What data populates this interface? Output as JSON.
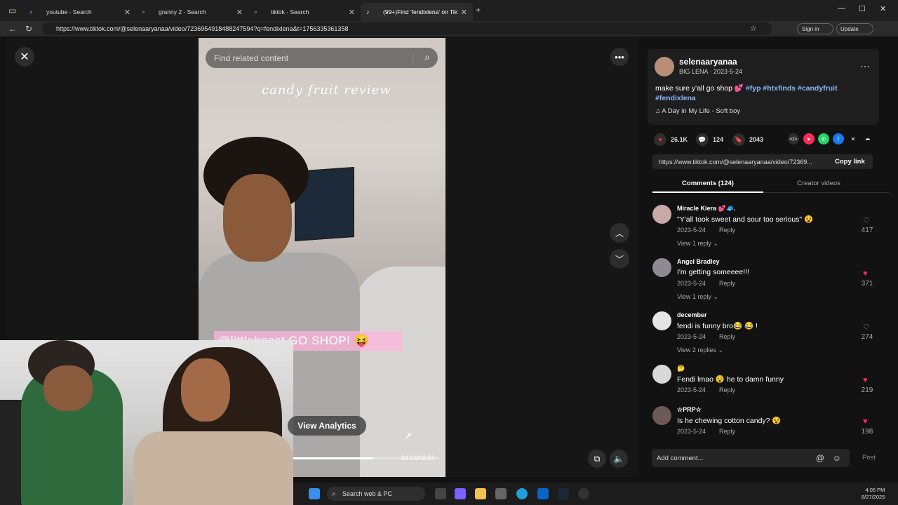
{
  "browser": {
    "tabs": [
      {
        "title": "youtube - Search"
      },
      {
        "title": "granny 2 - Search"
      },
      {
        "title": "tiktok - Search"
      },
      {
        "title": "(99+)Find 'fendixlena' on Tik"
      }
    ],
    "url": "https://www.tiktok.com/@selenaaryanaa/video/7236954918488247594?q=fendixlena&t=1756335361358",
    "sign_in": "Sign in",
    "update": "Update"
  },
  "video": {
    "search_placeholder": "Find related content",
    "overlay_title": "candy fruit review",
    "overlay_caption": "@littlebeast GO SHOP! 😝",
    "analytics_button": "View Analytics",
    "time": "02:34/02:53",
    "progress_fraction": 0.55
  },
  "post": {
    "username": "selenaaryanaa",
    "subtitle": "BIG LENA · 2023-5-24",
    "description": "make sure y'all go shop 💕 ",
    "hashtags": [
      "#fyp",
      "#htxfinds",
      "#candyfruit",
      "#fendixlena"
    ],
    "music": "A Day in My Life - Soft boy",
    "likes": "26.1K",
    "comments": "124",
    "saves": "2043",
    "link": "https://www.tiktok.com/@selenaaryanaa/video/72369...",
    "copy_link": "Copy link",
    "tab_comments": "Comments (124)",
    "tab_creator": "Creator videos",
    "add_comment_placeholder": "Add comment...",
    "post_button": "Post"
  },
  "comments": [
    {
      "name": "Miracle Kiera 💕🧢.",
      "text": "\"Y'all took sweet and sour too serious\" 😵",
      "date": "2023-5-24",
      "reply": "Reply",
      "count": "417",
      "liked": false,
      "view_replies": "View 1 reply ⌄"
    },
    {
      "name": "Angel Bradley",
      "text": "I'm getting someeee!!!",
      "date": "2023-5-24",
      "reply": "Reply",
      "count": "371",
      "liked": true,
      "view_replies": "View 1 reply ⌄"
    },
    {
      "name": "december",
      "text": "fendi is funny bro😂 😂 !",
      "date": "2023-5-24",
      "reply": "Reply",
      "count": "274",
      "liked": false,
      "view_replies": "View 2 replies ⌄"
    },
    {
      "name": "🤔",
      "text": "Fendi lmao 😵 he to damn funny",
      "date": "2023-5-24",
      "reply": "Reply",
      "count": "219",
      "liked": true,
      "view_replies": ""
    },
    {
      "name": "☆PRP☆",
      "text": "Is he chewing cotton candy? 😵",
      "date": "2023-5-24",
      "reply": "Reply",
      "count": "198",
      "liked": true,
      "view_replies": ""
    }
  ],
  "taskbar": {
    "search": "Search web & PC",
    "time": "4:05 PM",
    "date": "8/27/2025"
  },
  "colors": {
    "accent_pink": "#fe2c55",
    "hashtag": "#8ab4f8"
  }
}
